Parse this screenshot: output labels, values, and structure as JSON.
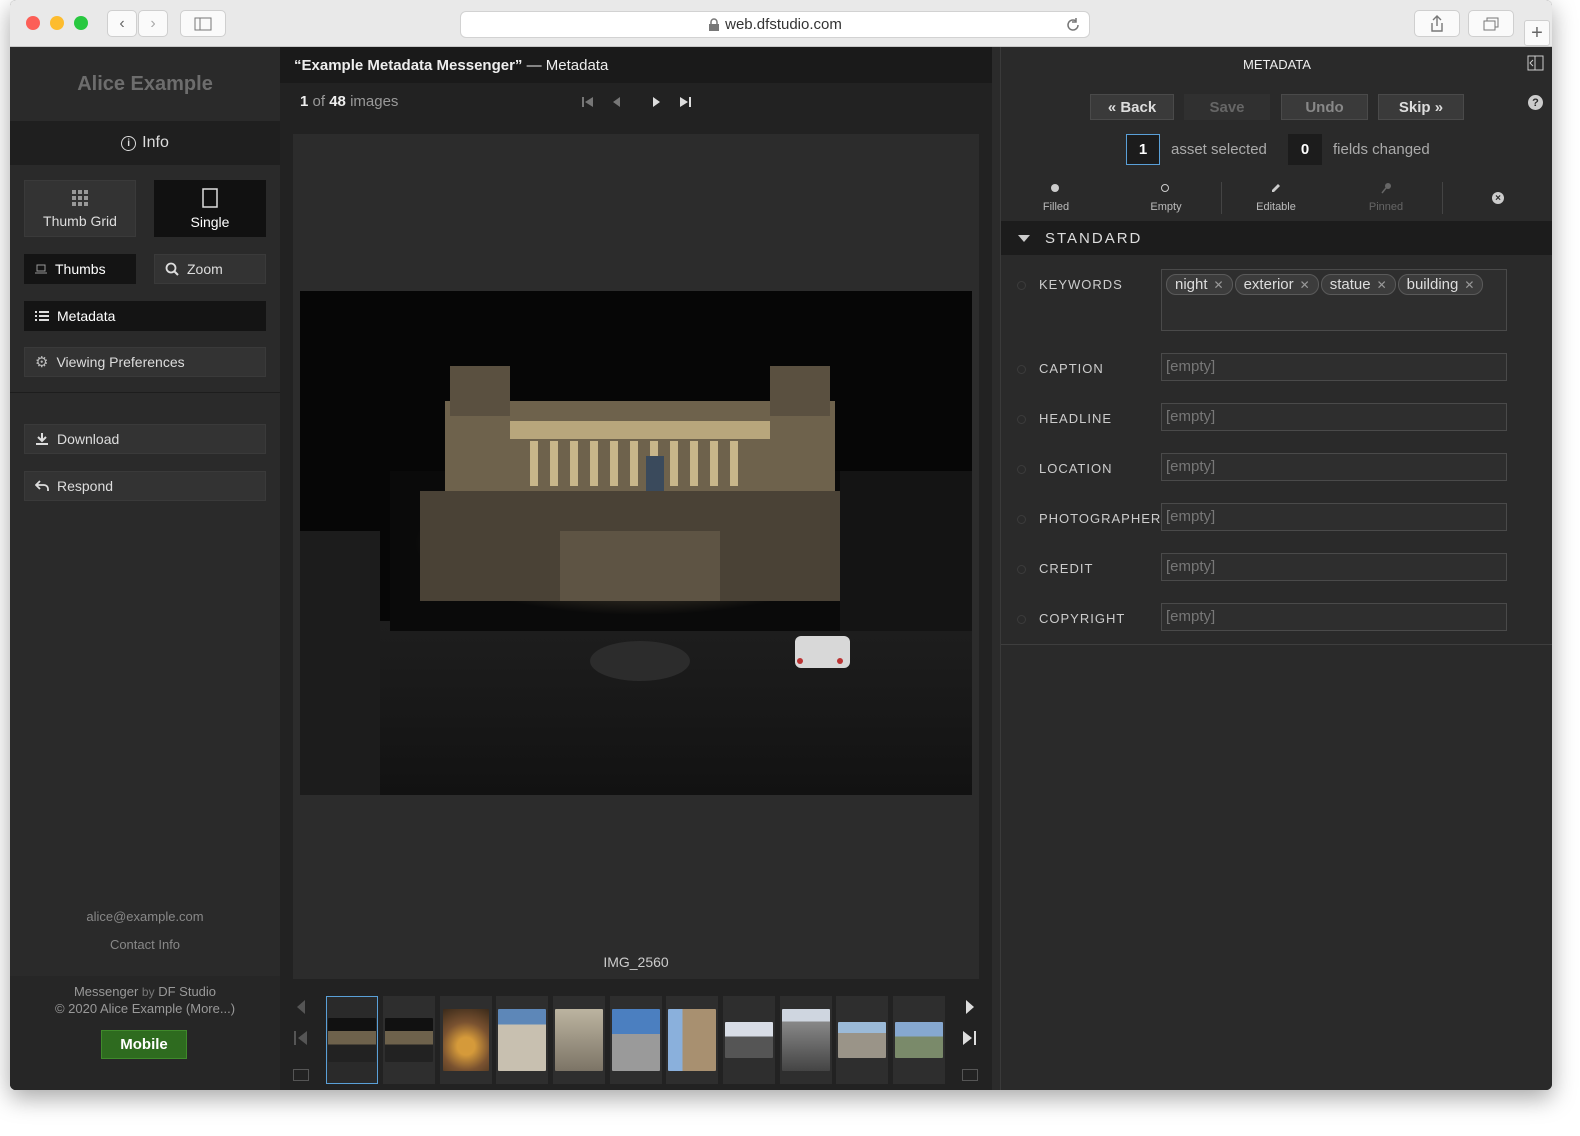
{
  "browser": {
    "url": "web.dfstudio.com"
  },
  "sidebar": {
    "title": "Alice Example",
    "info_label": "Info",
    "view_thumb_grid": "Thumb Grid",
    "view_single": "Single",
    "thumbs_label": "Thumbs",
    "zoom_label": "Zoom",
    "metadata_label": "Metadata",
    "viewing_prefs_label": "Viewing Preferences",
    "download_label": "Download",
    "respond_label": "Respond",
    "email": "alice@example.com",
    "contact": "Contact Info",
    "footer_app": "Messenger",
    "footer_by": "by",
    "footer_studio": "DF Studio",
    "footer_copyright": "© 2020 Alice Example (More...)",
    "mobile_label": "Mobile"
  },
  "main": {
    "title_quoted": "“Example Metadata Messenger”",
    "title_suffix": " — Metadata",
    "index": "1",
    "of_word": "of",
    "total": "48",
    "images_word": "images",
    "image_name": "IMG_2560"
  },
  "metadata": {
    "header": "METADATA",
    "back_label": "« Back",
    "save_label": "Save",
    "undo_label": "Undo",
    "skip_label": "Skip »",
    "assets_count": "1",
    "assets_text": "asset selected",
    "fields_count": "0",
    "fields_text": "fields changed",
    "legend": {
      "filled": "Filled",
      "empty": "Empty",
      "editable": "Editable",
      "pinned": "Pinned"
    },
    "section": "STANDARD",
    "keywords_label": "KEYWORDS",
    "keywords": [
      "night",
      "exterior",
      "statue",
      "building"
    ],
    "fields": [
      {
        "label": "CAPTION",
        "value": "[empty]"
      },
      {
        "label": "HEADLINE",
        "value": "[empty]"
      },
      {
        "label": "LOCATION",
        "value": "[empty]"
      },
      {
        "label": "PHOTOGRAPHER",
        "value": "[empty]"
      },
      {
        "label": "CREDIT",
        "value": "[empty]"
      },
      {
        "label": "COPYRIGHT",
        "value": "[empty]"
      }
    ]
  },
  "colors": {
    "accent_blue": "#5aa0d8",
    "mobile_green": "#2e6b1f",
    "panel_dark": "#2a2a2a"
  }
}
